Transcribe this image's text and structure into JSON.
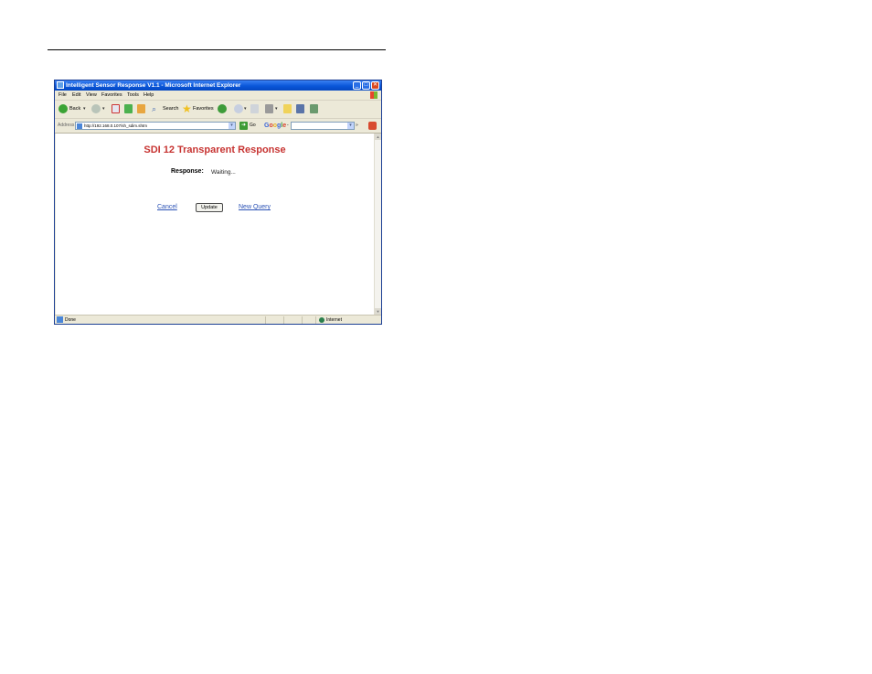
{
  "window": {
    "title": "Intelligent Sensor Response V1.1 - Microsoft Internet Explorer"
  },
  "menu": [
    "File",
    "Edit",
    "View",
    "Favorites",
    "Tools",
    "Help"
  ],
  "toolbar": {
    "back_label": "Back",
    "search_label": "Search",
    "favorites_label": "Favorites"
  },
  "address": {
    "label": "Address",
    "url": "http://192.168.0.107/sh_sdim.shtm",
    "go_label": "Go"
  },
  "google": {
    "logo": "Google",
    "dropdown": "-"
  },
  "page": {
    "title": "SDI 12 Transparent Response",
    "response_label": "Response:",
    "response_value": "Waiting...",
    "cancel_link": "Cancel",
    "update_button": "Update",
    "new_query_link": "New Query"
  },
  "status": {
    "text": "Done",
    "zone": "Internet"
  },
  "colors": {
    "title_red": "#c73432",
    "link_blue": "#2b52b5",
    "titlebar_blue": "#0a56d9"
  }
}
